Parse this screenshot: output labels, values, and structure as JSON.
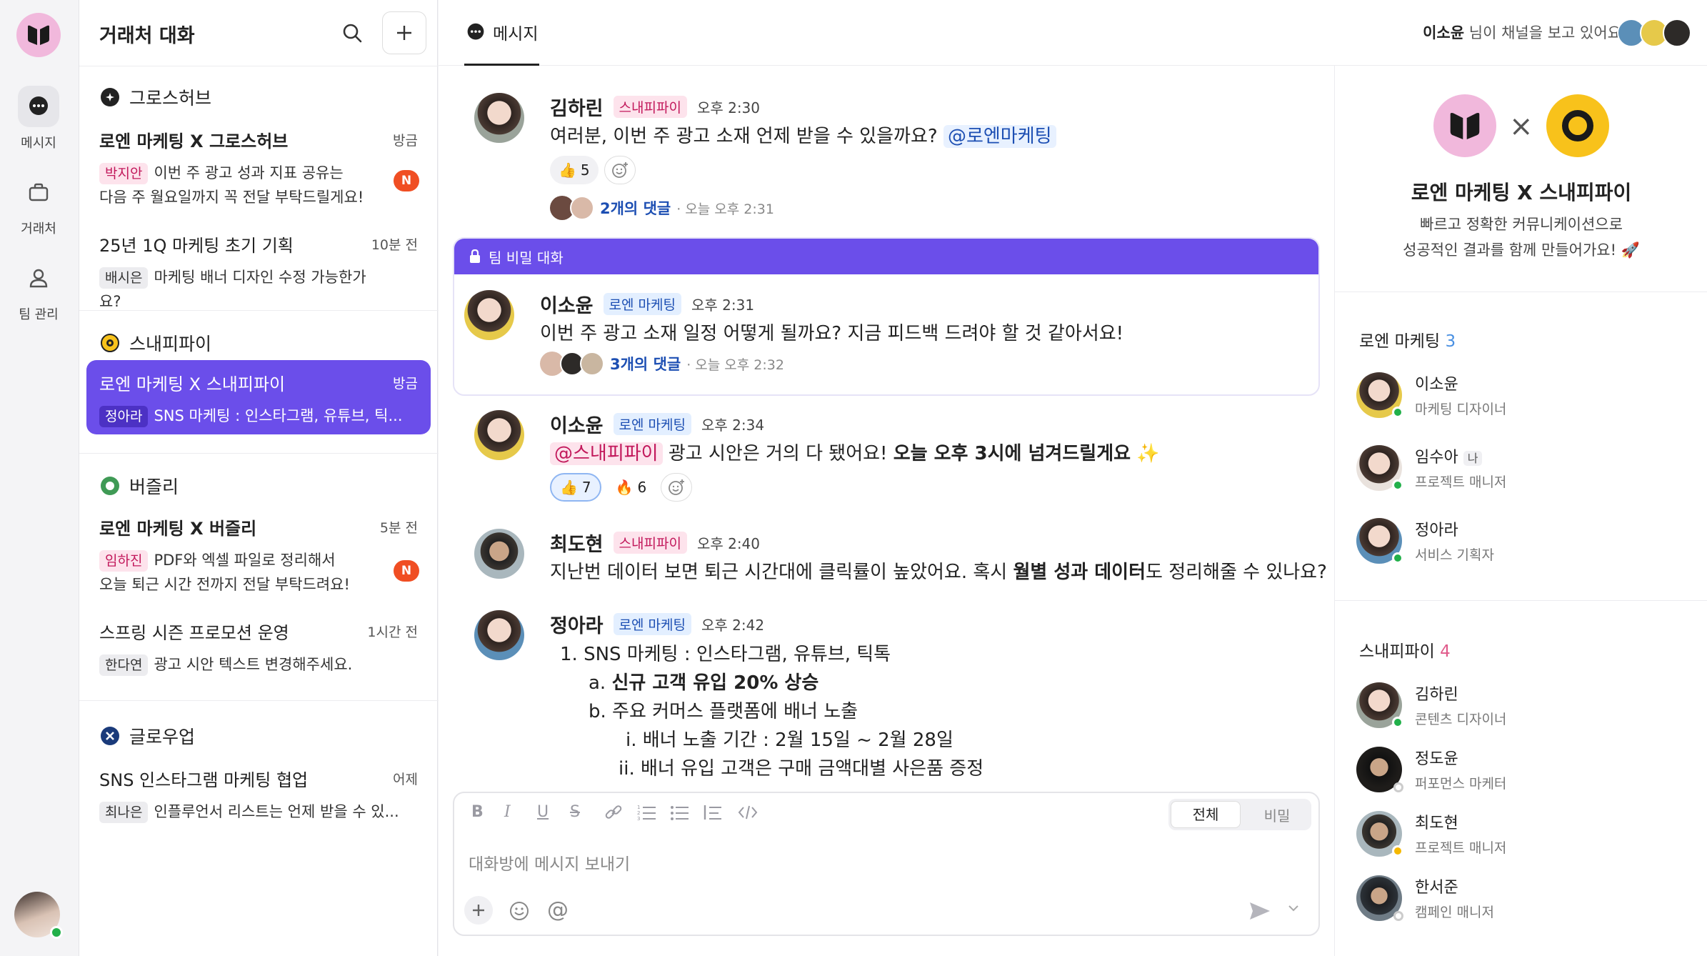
{
  "rail": {
    "items": [
      {
        "label": "메시지",
        "icon": "chat-bubble-icon"
      },
      {
        "label": "거래처",
        "icon": "briefcase-icon"
      },
      {
        "label": "팀 관리",
        "icon": "person-icon"
      }
    ]
  },
  "conversations": {
    "title": "거래처 대화",
    "groups": [
      {
        "name": "그로스허브",
        "items": [
          {
            "title": "로엔 마케팅 X 그로스허브",
            "time": "방금",
            "sender": "박지안",
            "preview1": "이번 주 광고 성과 지표 공유는",
            "preview2": "다음 주 월요일까지 꼭 전달 부탁드릴게요!",
            "badge": "N"
          },
          {
            "title": "25년 1Q 마케팅 초기 기획",
            "time": "10분 전",
            "sender": "배시은",
            "preview1": "마케팅 배너 디자인 수정 가능한가요?"
          }
        ]
      },
      {
        "name": "스내피파이",
        "items": [
          {
            "title": "로엔 마케팅 X 스내피파이",
            "time": "방금",
            "sender": "정아라",
            "preview1": "SNS 마케팅 : 인스타그램, 유튜브, 틱..."
          }
        ]
      },
      {
        "name": "버즐리",
        "items": [
          {
            "title": "로엔 마케팅 X 버즐리",
            "time": "5분 전",
            "sender": "임하진",
            "preview1": "PDF와 엑셀 파일로 정리해서",
            "preview2": "오늘 퇴근 시간 전까지 전달 부탁드려요!",
            "badge": "N"
          },
          {
            "title": "스프링 시즌 프로모션 운영",
            "time": "1시간 전",
            "sender": "한다연",
            "preview1": "광고 시안 텍스트 변경해주세요."
          }
        ]
      },
      {
        "name": "글로우업",
        "items": [
          {
            "title": "SNS 인스타그램 마케팅 협업",
            "time": "어제",
            "sender": "최나은",
            "preview1": "인플루언서 리스트는 언제 받을 수 있..."
          }
        ]
      }
    ]
  },
  "topbar": {
    "tab": "메시지",
    "viewer_name": "이소윤",
    "viewer_text": "님이 채널을 보고 있어요"
  },
  "messages": {
    "m1": {
      "name": "김하린",
      "label": "스내피파이",
      "time": "오후 2:30",
      "text": "여러분, 이번 주 광고 소재 언제 받을 수 있을까요?",
      "mention": "@로엔마케팅",
      "react_count": "5",
      "replies": "2개의 댓글",
      "reply_time": "· 오늘 오후 2:31"
    },
    "secret_label": "팀 비밀 대화",
    "m2": {
      "name": "이소윤",
      "label": "로엔 마케팅",
      "time": "오후 2:31",
      "text": "이번 주 광고 소재 일정 어떻게 될까요? 지금 피드백 드려야 할 것 같아서요!",
      "replies": "3개의 댓글",
      "reply_time": "· 오늘 오후 2:32"
    },
    "m3": {
      "name": "이소윤",
      "label": "로엔 마케팅",
      "time": "오후 2:34",
      "mention": "@스내피파이",
      "text_a": " 광고 시안은 거의 다 됐어요! ",
      "text_b": "오늘 오후 3시에 넘겨드릴게요",
      "react1": "7",
      "react2": "6"
    },
    "m4": {
      "name": "최도현",
      "label": "스내피파이",
      "time": "오후 2:40",
      "text_a": "지난번 데이터 보면 퇴근 시간대에 클릭률이 높았어요. 혹시 ",
      "text_b": "월별 성과 데이터",
      "text_c": "도 정리해줄 수 있나요?"
    },
    "m5": {
      "name": "정아라",
      "label": "로엔 마케팅",
      "time": "오후 2:42",
      "l1": "1.  SNS 마케팅 : 인스타그램, 유튜브, 틱톡",
      "l2a": "a.  ",
      "l2b": "신규 고객 유입 20% 상승",
      "l3": "b.  주요 커머스 플랫폼에 배너 노출",
      "l4": "i.  배너 노출 기간 : 2월 15일 ~ 2월 28일",
      "l5": "ii.  배너 유입 고객은 구매 금액대별 사은품 증정"
    }
  },
  "editor": {
    "seg_all": "전체",
    "seg_secret": "비밀",
    "placeholder": "대화방에 메시지 보내기"
  },
  "panel": {
    "x": "×",
    "title": "로엔 마케팅 X 스내피파이",
    "desc1": "빠르고 정확한 커뮤니케이션으로",
    "desc2": "성공적인 결과를 함께 만들어가요! 🚀",
    "team1": {
      "name": "로엔 마케팅",
      "count": "3",
      "members": [
        {
          "name": "이소윤",
          "role": "마케팅 디자이너"
        },
        {
          "name": "임수아",
          "role": "프로젝트 매니저",
          "me": "나"
        },
        {
          "name": "정아라",
          "role": "서비스 기획자"
        }
      ]
    },
    "team2": {
      "name": "스내피파이",
      "count": "4",
      "members": [
        {
          "name": "김하린",
          "role": "콘텐츠 디자이너"
        },
        {
          "name": "정도윤",
          "role": "퍼포먼스 마케터"
        },
        {
          "name": "최도현",
          "role": "프로젝트 매니저"
        },
        {
          "name": "한서준",
          "role": "캠페인 매니저"
        }
      ]
    }
  },
  "colors": {
    "accent": "#6b4eea",
    "brand_pink": "#f1b8dc",
    "brand_yellow": "#f8c21b",
    "badge": "#f04e23",
    "online": "#22b04a"
  }
}
